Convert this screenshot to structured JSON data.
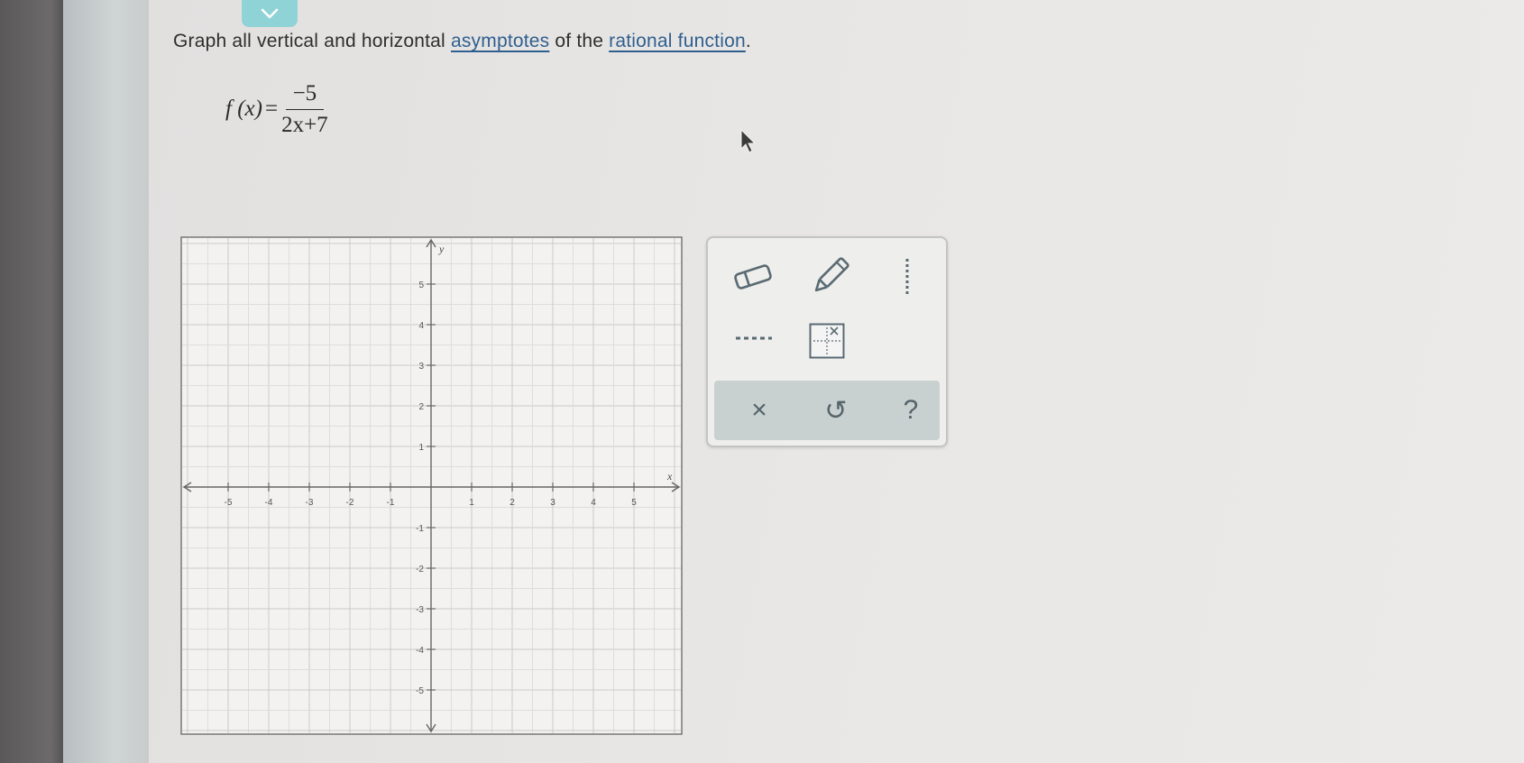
{
  "header": {
    "collapse_icon": "chevron-down-icon"
  },
  "question": {
    "text_before": "Graph all vertical and horizontal ",
    "link1": "asymptotes",
    "text_middle": " of the ",
    "link2": "rational function",
    "text_after": "."
  },
  "formula": {
    "lhs": "f (x)",
    "eq": "=",
    "numerator": "−5",
    "denominator": "2x+7"
  },
  "graph": {
    "x_label": "x",
    "y_label": "y",
    "x_ticks": [
      "-5",
      "-4",
      "-3",
      "-2",
      "-1",
      "1",
      "2",
      "3",
      "4",
      "5"
    ],
    "y_ticks": [
      "5",
      "4",
      "3",
      "2",
      "1",
      "-1",
      "-2",
      "-3",
      "-4",
      "-5"
    ]
  },
  "toolbox": {
    "tools": [
      "eraser-icon",
      "pencil-icon",
      "dotted-line-icon",
      "dashed-line-icon",
      "asymptote-grid-icon"
    ],
    "actions": {
      "clear": "×",
      "undo": "↺",
      "help": "?"
    }
  },
  "colors": {
    "accent": "#8fd3d6",
    "link": "#2f5f8f",
    "action_bar": "#c9d0d0"
  }
}
